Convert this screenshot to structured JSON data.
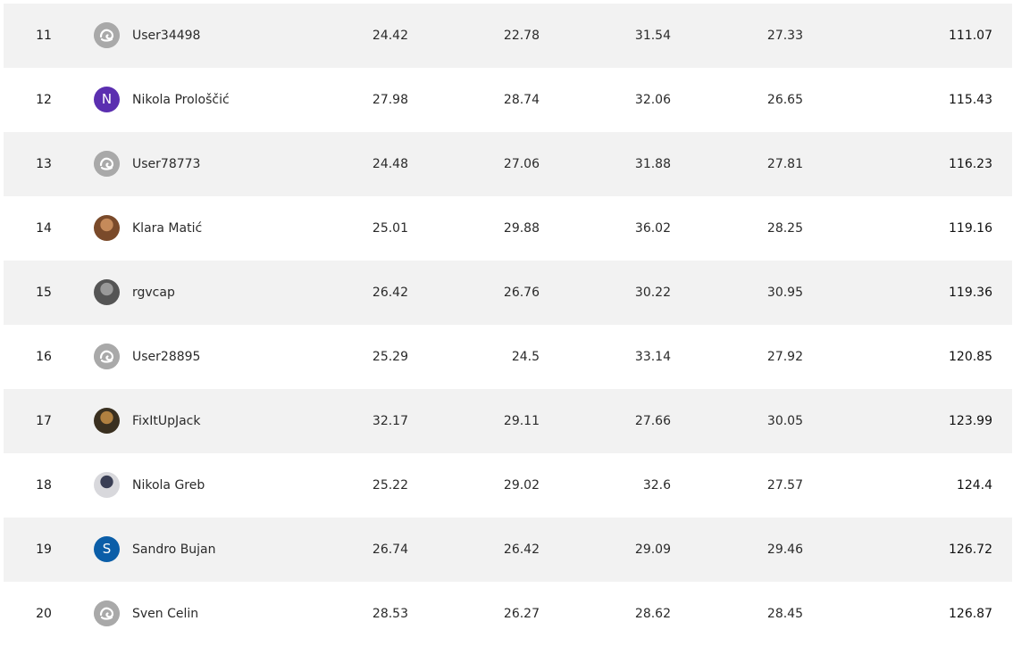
{
  "leaderboard": {
    "rows": [
      {
        "rank": "11",
        "name": "User34498",
        "avatar": {
          "kind": "default",
          "icon": "default-avatar-icon"
        },
        "s1": "24.42",
        "s2": "22.78",
        "s3": "31.54",
        "s4": "27.33",
        "total": "111.07"
      },
      {
        "rank": "12",
        "name": "Nikola Prološčić",
        "avatar": {
          "kind": "letter",
          "letter": "N",
          "color": "#5b2fb0"
        },
        "s1": "27.98",
        "s2": "28.74",
        "s3": "32.06",
        "s4": "26.65",
        "total": "115.43"
      },
      {
        "rank": "13",
        "name": "User78773",
        "avatar": {
          "kind": "default",
          "icon": "default-avatar-icon"
        },
        "s1": "24.48",
        "s2": "27.06",
        "s3": "31.88",
        "s4": "27.81",
        "total": "116.23"
      },
      {
        "rank": "14",
        "name": "Klara Matić",
        "avatar": {
          "kind": "photo",
          "colors": [
            "#7a4a2a",
            "#c58a5a"
          ]
        },
        "s1": "25.01",
        "s2": "29.88",
        "s3": "36.02",
        "s4": "28.25",
        "total": "119.16"
      },
      {
        "rank": "15",
        "name": "rgvcap",
        "avatar": {
          "kind": "photo",
          "colors": [
            "#555555",
            "#999999"
          ]
        },
        "s1": "26.42",
        "s2": "26.76",
        "s3": "30.22",
        "s4": "30.95",
        "total": "119.36"
      },
      {
        "rank": "16",
        "name": "User28895",
        "avatar": {
          "kind": "default",
          "icon": "default-avatar-icon"
        },
        "s1": "25.29",
        "s2": "24.5",
        "s3": "33.14",
        "s4": "27.92",
        "total": "120.85"
      },
      {
        "rank": "17",
        "name": "FixItUpJack",
        "avatar": {
          "kind": "photo",
          "colors": [
            "#3a3020",
            "#b08040"
          ]
        },
        "s1": "32.17",
        "s2": "29.11",
        "s3": "27.66",
        "s4": "30.05",
        "total": "123.99"
      },
      {
        "rank": "18",
        "name": "Nikola Greb",
        "avatar": {
          "kind": "photo",
          "colors": [
            "#d8d8dc",
            "#3a3f55"
          ]
        },
        "s1": "25.22",
        "s2": "29.02",
        "s3": "32.6",
        "s4": "27.57",
        "total": "124.4"
      },
      {
        "rank": "19",
        "name": "Sandro Bujan",
        "avatar": {
          "kind": "letter",
          "letter": "S",
          "color": "#0b5ea8"
        },
        "s1": "26.74",
        "s2": "26.42",
        "s3": "29.09",
        "s4": "29.46",
        "total": "126.72"
      },
      {
        "rank": "20",
        "name": "Sven Celin",
        "avatar": {
          "kind": "default",
          "icon": "default-avatar-icon"
        },
        "s1": "28.53",
        "s2": "26.27",
        "s3": "28.62",
        "s4": "28.45",
        "total": "126.87"
      }
    ]
  },
  "colors": {
    "row_alt_bg": "#f2f2f2",
    "default_avatar_bg": "#a9a9a9"
  }
}
